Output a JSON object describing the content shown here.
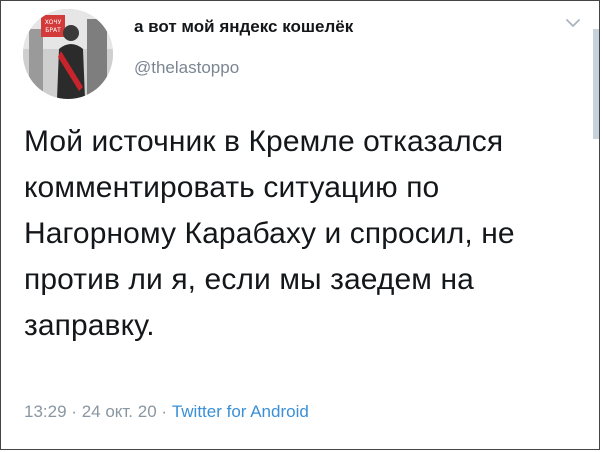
{
  "tweet": {
    "display_name": "а вот мой яндекс кошелёк",
    "handle": "@thelastoppo",
    "text": "Мой источник в Кремле отказался комментировать ситуацию по Нагорному Карабаху и спросил, не против ли я, если мы заедем на заправку.",
    "time": "13:29",
    "separator": "·",
    "date": "24 окт. 20",
    "source": "Twitter for Android"
  },
  "avatar": {
    "sign_text": "ХОЧУ БРАТ"
  },
  "icons": {
    "menu": "chevron-down-icon"
  },
  "colors": {
    "text": "#14171a",
    "secondary": "#8a96a2",
    "link": "#3a8fd6",
    "sash": "#c8242b"
  }
}
